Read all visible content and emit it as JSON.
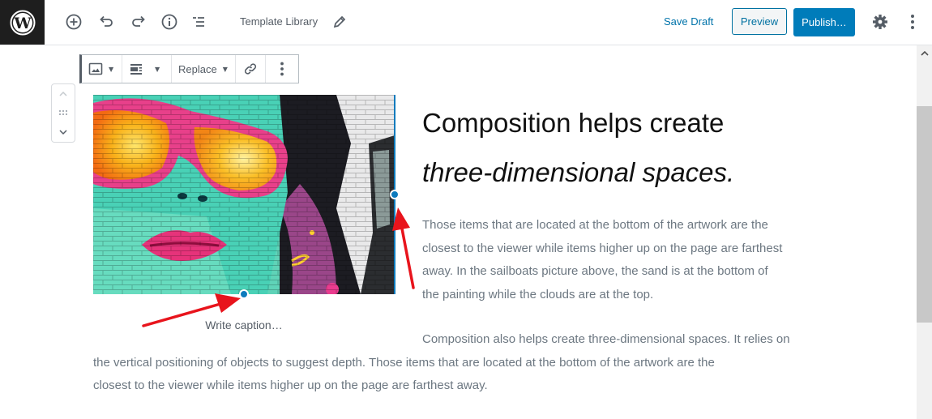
{
  "topbar": {
    "logo": "wordpress-logo",
    "icons": [
      "add-block-icon",
      "undo-icon",
      "redo-icon",
      "info-icon",
      "block-navigation-icon"
    ],
    "document_title": "Template Library",
    "edit_title_icon": "pencil-icon",
    "save_draft_label": "Save Draft",
    "preview_label": "Preview",
    "publish_label": "Publish…",
    "settings_icon": "gear-icon",
    "more_icon": "vertical-ellipsis-icon"
  },
  "block_toolbar": {
    "block_type_icon": "image-icon",
    "align_icon": "media-text-align-icon",
    "replace_label": "Replace",
    "link_icon": "link-icon",
    "more_icon": "vertical-ellipsis-icon"
  },
  "block_mover": {
    "up_icon": "chevron-up-icon",
    "drag_icon": "drag-handle-icon",
    "down_icon": "chevron-down-icon"
  },
  "image_block": {
    "description": "Colorful graffiti mural of a woman with pink-framed orange sunglasses on a brick wall",
    "caption_placeholder": "Write caption…"
  },
  "content": {
    "heading_line1": "Composition helps create",
    "heading_line2": "three-dimensional spaces.",
    "paragraph1_lines": [
      "Those items that are located at the bottom of the artwork are the",
      "closest to the viewer while items higher up on the page are farthest",
      "away. In the sailboats picture above, the sand is at the bottom of",
      "the painting while the clouds are at the top."
    ],
    "paragraph2_lines": [
      "Composition also helps create three-dimensional spaces. It relies on",
      "the vertical positioning of objects to suggest depth. Those items that are located at the bottom of the artwork are the",
      "closest to the viewer while items higher up on the page are farthest away."
    ]
  },
  "colors": {
    "accent": "#007cba",
    "handle": "#0e7bbd",
    "annotation_arrow": "#e8141c",
    "dark": "#1e1e1e"
  }
}
